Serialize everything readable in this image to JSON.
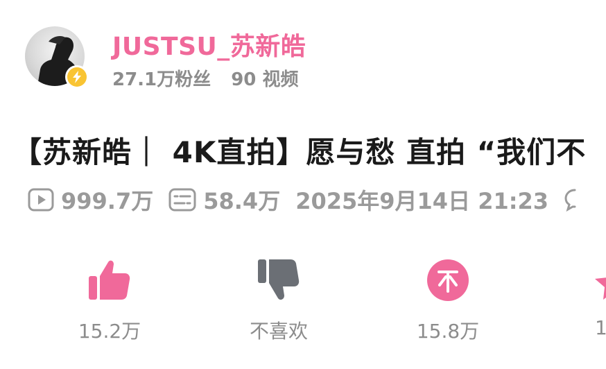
{
  "author": {
    "name": "JUSTSU_苏新皓",
    "followers": "27.1万粉丝",
    "videos": "90 视频"
  },
  "video": {
    "title": "【苏新皓｜ 4K直拍】愿与愁 直拍 “我们不",
    "plays": "999.7万",
    "danmaku": "58.4万",
    "date": "2025年9月14日 21:23"
  },
  "actions": {
    "like_count": "15.2万",
    "dislike_label": "不喜欢",
    "coin_count": "15.8万",
    "fav_count": "1"
  },
  "colors": {
    "accent": "#f0699a",
    "verified": "#f9c433",
    "muted": "#9a9a9a",
    "dislike": "#6b6f75"
  },
  "icons": [
    "play-count-icon",
    "danmaku-icon",
    "comment-icon",
    "like-icon",
    "dislike-icon",
    "coin-icon",
    "favorite-icon",
    "verified-icon"
  ]
}
